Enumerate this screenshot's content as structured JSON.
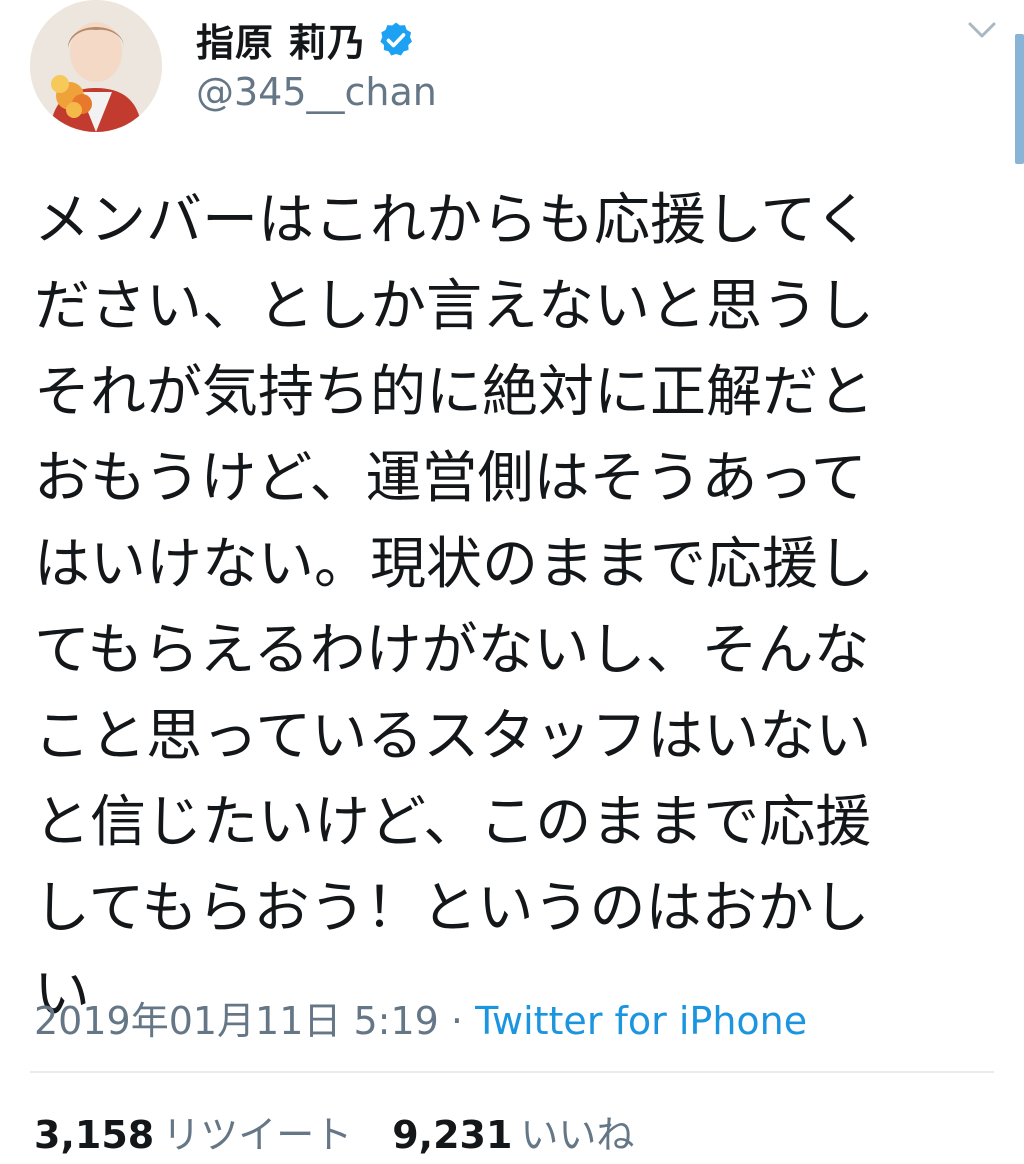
{
  "author": {
    "name": "指原 莉乃",
    "handle": "@345__chan",
    "verified": true
  },
  "tweet": {
    "lines": [
      "メンバーはこれからも応援してく",
      "ださい、としか言えないと思うし",
      "それが気持ち的に絶対に正解だと",
      "おもうけど、運営側はそうあって",
      "はいけない。現状のままで応援し",
      "てもらえるわけがないし、そんな",
      "こと思っているスタッフはいない",
      "と信じたいけど、このままで応援",
      "してもらおう！というのはおかし",
      "い"
    ],
    "timestamp": "2019年01月11日 5:19",
    "separator": " · ",
    "source": "Twitter for iPhone"
  },
  "stats": {
    "retweets_count": "3,158",
    "retweets_label": "リツイート",
    "likes_count": "9,231",
    "likes_label": "いいね"
  },
  "icons": {
    "verified": "verified-badge-icon",
    "menu": "chevron-down-icon"
  },
  "colors": {
    "verified_blue": "#1da1f2",
    "link_blue": "#1b95e0",
    "secondary_text": "#657786"
  }
}
